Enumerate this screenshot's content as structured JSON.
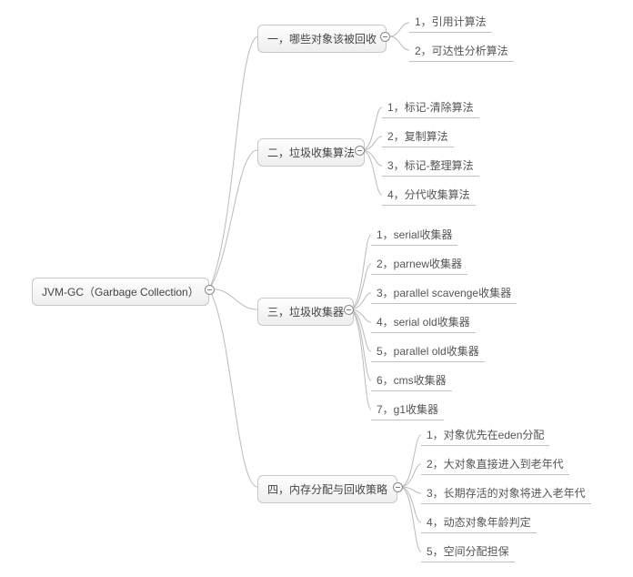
{
  "root": {
    "label": "JVM-GC（Garbage Collection）"
  },
  "branches": [
    {
      "label": "一，哪些对象该被回收",
      "leaves": [
        "1，引用计算法",
        "2，可达性分析算法"
      ]
    },
    {
      "label": "二，垃圾收集算法",
      "leaves": [
        "1，标记-清除算法",
        "2，复制算法",
        "3，标记-整理算法",
        "4，分代收集算法"
      ]
    },
    {
      "label": "三，垃圾收集器",
      "leaves": [
        "1，serial收集器",
        "2，parnew收集器",
        "3，parallel scavenge收集器",
        "4，serial old收集器",
        "5，parallel old收集器",
        "6，cms收集器",
        "7，g1收集器"
      ]
    },
    {
      "label": "四，内存分配与回收策略",
      "leaves": [
        "1，对象优先在eden分配",
        "2，大对象直接进入到老年代",
        "3，长期存活的对象将进入老年代",
        "4，动态对象年龄判定",
        "5，空间分配担保"
      ]
    }
  ]
}
